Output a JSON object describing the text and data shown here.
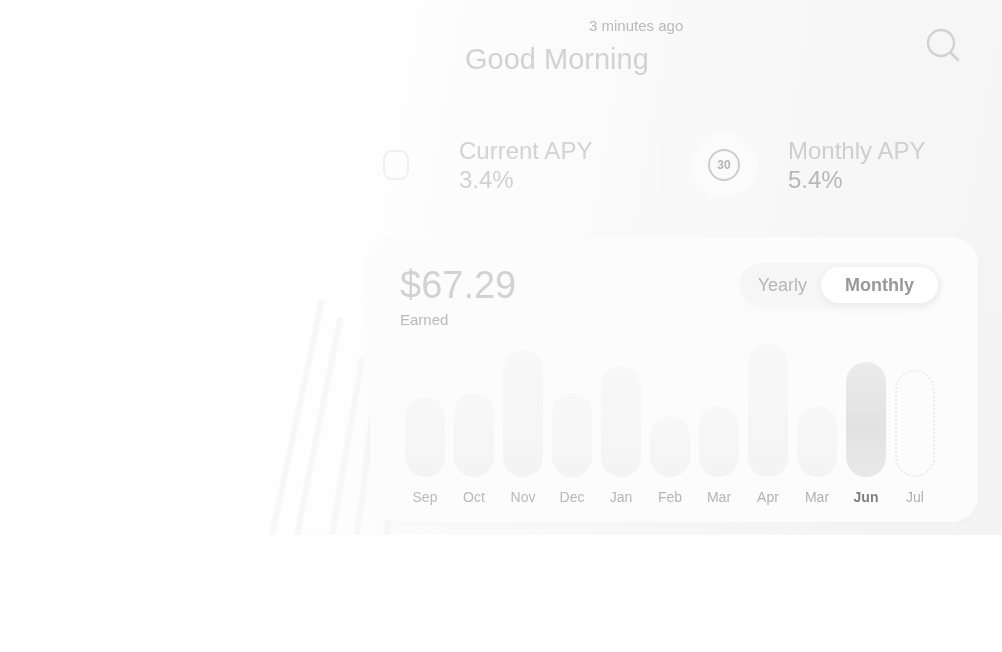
{
  "header": {
    "subtitle": "3 minutes ago",
    "title": "Good Morning"
  },
  "stats": [
    {
      "kind": "square",
      "label": "Current APY",
      "value": "3.4%"
    },
    {
      "kind": "timer",
      "badge": "30",
      "label": "Monthly APY",
      "value": "5.4%"
    }
  ],
  "earnings": {
    "amount": "$67.29",
    "caption": "Earned"
  },
  "period_tabs": [
    {
      "label": "Yearly",
      "selected": false
    },
    {
      "label": "Monthly",
      "selected": true
    }
  ],
  "months": [
    {
      "label": "Sep",
      "kind": "bar",
      "selected": false
    },
    {
      "label": "Oct",
      "kind": "bar",
      "selected": false
    },
    {
      "label": "Nov",
      "kind": "bar",
      "selected": false
    },
    {
      "label": "Dec",
      "kind": "bar",
      "selected": false
    },
    {
      "label": "Jan",
      "kind": "bar",
      "selected": false
    },
    {
      "label": "Feb",
      "kind": "bar",
      "selected": false
    },
    {
      "label": "Mar",
      "kind": "bar",
      "selected": false
    },
    {
      "label": "Apr",
      "kind": "bar",
      "selected": false
    },
    {
      "label": "Mar",
      "kind": "bar",
      "selected": false
    },
    {
      "label": "Jun",
      "kind": "bar",
      "selected": true
    },
    {
      "label": "Jul",
      "kind": "projected",
      "selected": false
    }
  ]
}
